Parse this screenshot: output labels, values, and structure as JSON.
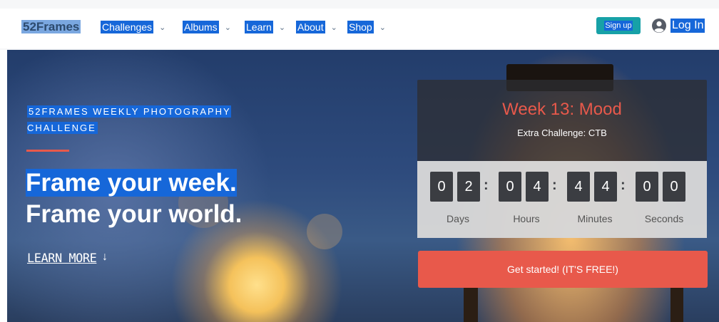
{
  "nav": {
    "logo": "52Frames",
    "items": [
      {
        "label": "Challenges"
      },
      {
        "label": "Albums"
      },
      {
        "label": "Learn"
      },
      {
        "label": "About"
      },
      {
        "label": "Shop"
      }
    ],
    "signup": "Sign up",
    "login": "Log In",
    "chevron_icon": "chevron-down-icon",
    "user_icon": "user-circle-icon"
  },
  "hero": {
    "eyebrow": "52FRAMES WEEKLY PHOTOGRAPHY CHALLENGE",
    "headline_line1": "Frame your week.",
    "headline_line2": "Frame your world.",
    "learn_more": "LEARN MORE",
    "learn_more_arrow": "↓"
  },
  "panel": {
    "title": "Week 13: Mood",
    "subtitle": "Extra Challenge: CTB",
    "digits": [
      "0",
      "2",
      "0",
      "4",
      "4",
      "4",
      "0",
      "0"
    ],
    "units": {
      "days": "Days",
      "hours": "Hours",
      "minutes": "Minutes",
      "seconds": "Seconds"
    },
    "cta": "Get started! (IT'S FREE!)"
  },
  "colors": {
    "accent": "#e8594b",
    "selection": "#1667d9",
    "teal": "#17a1a7",
    "digit_bg": "#3b3d42"
  }
}
